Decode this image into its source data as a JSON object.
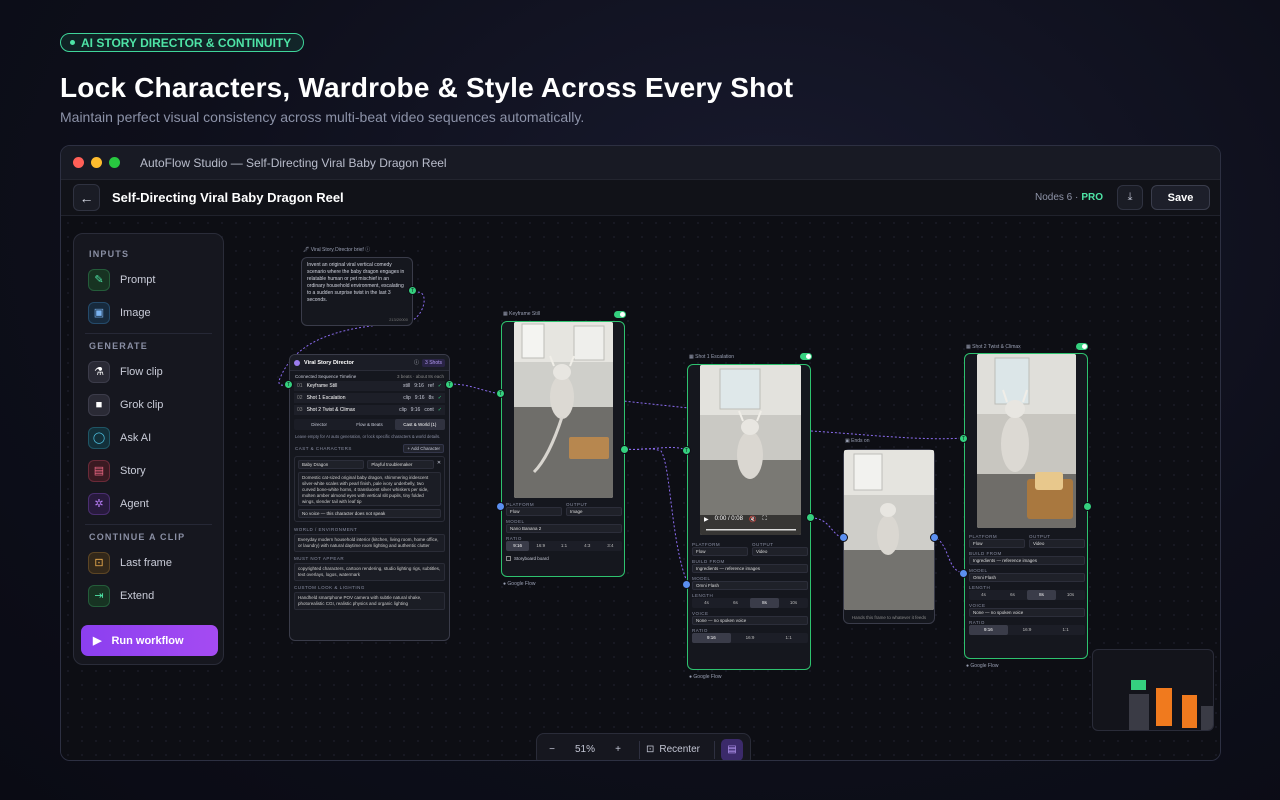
{
  "header": {
    "badge": "AI STORY DIRECTOR & CONTINUITY",
    "title": "Lock Characters, Wardrobe & Style Across Every Shot",
    "subtitle": "Maintain perfect visual consistency across multi-beat video sequences automatically."
  },
  "window": {
    "title": "AutoFlow Studio — Self-Directing Viral Baby Dragon Reel"
  },
  "app": {
    "page_title": "Self-Directing Viral Baby Dragon Reel",
    "nodes_label": "Nodes 6 ·",
    "plan": "PRO",
    "save_label": "Save"
  },
  "sidebar": {
    "inputs_title": "INPUTS",
    "inputs": [
      {
        "label": "Prompt",
        "icon": "pencil-icon"
      },
      {
        "label": "Image",
        "icon": "image-icon"
      }
    ],
    "generate_title": "GENERATE",
    "generate": [
      {
        "label": "Flow clip",
        "icon": "flask-icon"
      },
      {
        "label": "Grok clip",
        "icon": "square-icon"
      },
      {
        "label": "Ask AI",
        "icon": "chat-icon"
      },
      {
        "label": "Story",
        "icon": "film-icon"
      },
      {
        "label": "Agent",
        "icon": "gear-icon"
      }
    ],
    "continue_title": "CONTINUE A CLIP",
    "continue": [
      {
        "label": "Last frame",
        "icon": "frame-icon"
      },
      {
        "label": "Extend",
        "icon": "extend-icon"
      }
    ],
    "run_label": "Run workflow"
  },
  "nodes": {
    "brief": {
      "label": "Viral Story Director brief",
      "text": "Invent an original viral vertical comedy scenario where the baby dragon engages in relatable human or pet mischief in an ordinary household environment, escalating to a sudden surprise twist in the last 3 seconds.",
      "counter": "213/20000"
    },
    "director": {
      "title": "Viral Story Director",
      "shots_badge": "3 Shots",
      "timeline_label": "Connected Sequence Timeline",
      "timeline_meta": "3 beats · about 8s each",
      "beats": [
        {
          "num": "01",
          "name": "Keyframe Still",
          "kind": "still",
          "ratio": "9:16",
          "tag": "ref"
        },
        {
          "num": "02",
          "name": "Shot 1 Escalation",
          "kind": "clip",
          "ratio": "9:16",
          "tag": "8s"
        },
        {
          "num": "03",
          "name": "Shot 2 Twist & Climax",
          "kind": "clip",
          "ratio": "9:16",
          "tag": "cont"
        }
      ],
      "tabs": [
        "Director",
        "Flow & Beats",
        "Cast & World (1)"
      ],
      "hint": "Leave empty for AI auto generation, or lock specific characters & world details.",
      "cast_label": "CAST & CHARACTERS",
      "add_character": "+ Add Character",
      "char_name": "Baby Dragon",
      "char_role": "Playful troublemaker",
      "char_desc": "Domestic cat-sized original baby dragon, shimmering iridescent silver-white scales with pearl finish, pale ivory underbelly, two curved bone-white horns, 4 translucent silver whiskers per side, molten amber almond eyes with vertical slit pupils, tiny folded wings, slender tail with leaf tip",
      "voice": "No voice — this character does not speak",
      "world_label": "WORLD / ENVIRONMENT",
      "world_text": "Everyday modern household interior (kitchen, living room, home office, or laundry) with natural daytime room lighting and authentic clutter",
      "avoid_label": "MUST NOT APPEAR",
      "avoid_text": "copyrighted characters, cartoon rendering, studio lighting rigs, subtitles, text overlays, logos, watermark",
      "look_label": "CUSTOM LOOK & LIGHTING",
      "look_text": "Handheld smartphone POV camera with subtle natural shake, photorealistic CGI, realistic physics and organic lighting"
    },
    "keyframe": {
      "label": "Keyframe Still",
      "platform_label": "PLATFORM",
      "platform": "Flow",
      "output_label": "OUTPUT",
      "output": "Image",
      "model_label": "MODEL",
      "model": "Nano Banana 2",
      "ratio_label": "RATIO",
      "ratios": [
        "9:16",
        "16:9",
        "1:1",
        "4:3",
        "3:4"
      ],
      "storyboard": "Storyboard board",
      "footer": "Google Flow"
    },
    "shot1": {
      "label": "Shot 1 Escalation",
      "time": "0:00 / 0:08",
      "platform_label": "PLATFORM",
      "platform": "Flow",
      "output_label": "OUTPUT",
      "output": "Video",
      "build_label": "BUILD FROM",
      "build": "Ingredients — reference images",
      "model_label": "MODEL",
      "model": "Omni Flash",
      "length_label": "LENGTH",
      "lengths": [
        "4s",
        "6s",
        "8s",
        "10s"
      ],
      "voice_label": "VOICE",
      "voice": "None — no spoken voice",
      "ratio_label": "RATIO",
      "ratios": [
        "9:16",
        "16:9",
        "1:1"
      ],
      "footer": "Google Flow"
    },
    "endson": {
      "label": "Ends on",
      "caption": "Hands this frame to whatever it feeds"
    },
    "shot2": {
      "label": "Shot 2 Twist & Climax",
      "platform_label": "PLATFORM",
      "platform": "Flow",
      "output_label": "OUTPUT",
      "output": "Video",
      "build_label": "BUILD FROM",
      "build": "Ingredients — reference images",
      "model_label": "MODEL",
      "model": "Omni Flash",
      "length_label": "LENGTH",
      "lengths": [
        "4s",
        "6s",
        "8s",
        "10s"
      ],
      "voice_label": "VOICE",
      "voice": "None — no spoken voice",
      "ratio_label": "RATIO",
      "ratios": [
        "9:16",
        "16:9",
        "1:1"
      ],
      "footer": "Google Flow"
    }
  },
  "zoom": {
    "minus": "−",
    "value": "51%",
    "plus": "+",
    "recenter": "Recenter"
  },
  "colors": {
    "accent_green": "#35d07f",
    "accent_purple": "#9b45f1",
    "minimap_orange": "#f07a1e"
  }
}
